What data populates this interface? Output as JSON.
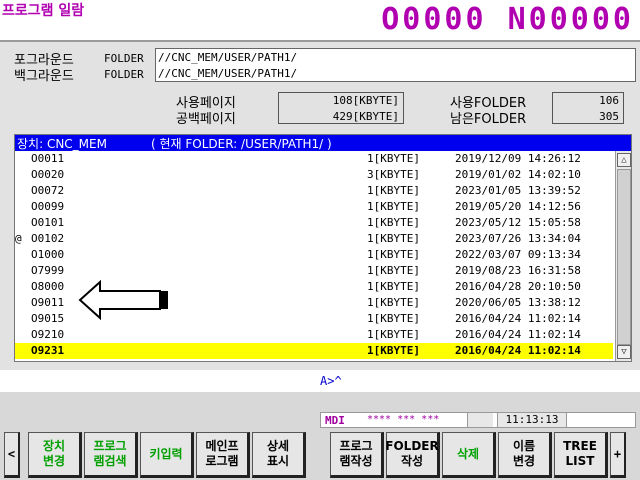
{
  "header": {
    "screen_title": "프로그램 일람",
    "program_number": "O0000 N00000"
  },
  "folders": {
    "foreground_label": "포그라운드",
    "background_label": "백그라운드",
    "folder_tag": "FOLDER",
    "foreground_path": "//CNC_MEM/USER/PATH1/",
    "background_path": "//CNC_MEM/USER/PATH1/"
  },
  "stats": {
    "used_pages_label": "사용페이지",
    "used_pages_value": "108[KBYTE]",
    "free_pages_label": "공백페이지",
    "free_pages_value": "429[KBYTE]",
    "used_folder_label": "사용FOLDER",
    "used_folder_value": "106",
    "remaining_folder_label": "남은FOLDER",
    "remaining_folder_value": "305"
  },
  "list": {
    "header_device": "장치: CNC_MEM",
    "header_current": "( 현재 FOLDER: /USER/PATH1/ )",
    "rows": [
      {
        "mark": "",
        "name": "O0011",
        "size": "1[KBYTE]",
        "date": "2019/12/09 14:26:12"
      },
      {
        "mark": "",
        "name": "O0020",
        "size": "3[KBYTE]",
        "date": "2019/01/02 14:02:10"
      },
      {
        "mark": "",
        "name": "O0072",
        "size": "1[KBYTE]",
        "date": "2023/01/05 13:39:52"
      },
      {
        "mark": "",
        "name": "O0099",
        "size": "1[KBYTE]",
        "date": "2019/05/20 14:12:56"
      },
      {
        "mark": "",
        "name": "O0101",
        "size": "1[KBYTE]",
        "date": "2023/05/12 15:05:58"
      },
      {
        "mark": "@",
        "name": "O0102",
        "size": "1[KBYTE]",
        "date": "2023/07/26 13:34:04"
      },
      {
        "mark": "",
        "name": "O1000",
        "size": "1[KBYTE]",
        "date": "2022/03/07 09:13:34"
      },
      {
        "mark": "",
        "name": "O7999",
        "size": "1[KBYTE]",
        "date": "2019/08/23 16:31:58"
      },
      {
        "mark": "",
        "name": "O8000",
        "size": "1[KBYTE]",
        "date": "2016/04/28 20:10:50"
      },
      {
        "mark": "",
        "name": "O9011",
        "size": "1[KBYTE]",
        "date": "2020/06/05 13:38:12"
      },
      {
        "mark": "",
        "name": "O9015",
        "size": "1[KBYTE]",
        "date": "2016/04/24 11:02:14"
      },
      {
        "mark": "",
        "name": "O9210",
        "size": "1[KBYTE]",
        "date": "2016/04/24 11:02:14"
      },
      {
        "mark": "",
        "name": "O9231",
        "size": "1[KBYTE]",
        "date": "2016/04/24 11:02:14"
      }
    ],
    "selected_index": 12
  },
  "input": {
    "prompt": "A>^"
  },
  "status": {
    "mode": "MDI",
    "indicators": "**** *** ***",
    "time": "11:13:13"
  },
  "softkeys": {
    "left_edge": "<",
    "right_edge": "+",
    "keys": [
      {
        "label": "장치\n변경",
        "color": "green"
      },
      {
        "label": "프로그\n램검색",
        "color": "green"
      },
      {
        "label": "키입력",
        "color": "green"
      },
      {
        "label": "메인프\n로그램",
        "color": "black"
      },
      {
        "label": "상세\n표시",
        "color": "black"
      },
      {
        "label": "프로그\n램작성",
        "color": "black"
      },
      {
        "label": "FOLDER\n작성",
        "color": "black"
      },
      {
        "label": "삭제",
        "color": "green"
      },
      {
        "label": "이름\n변경",
        "color": "black"
      },
      {
        "label": "TREE\nLIST",
        "color": "black"
      }
    ]
  }
}
